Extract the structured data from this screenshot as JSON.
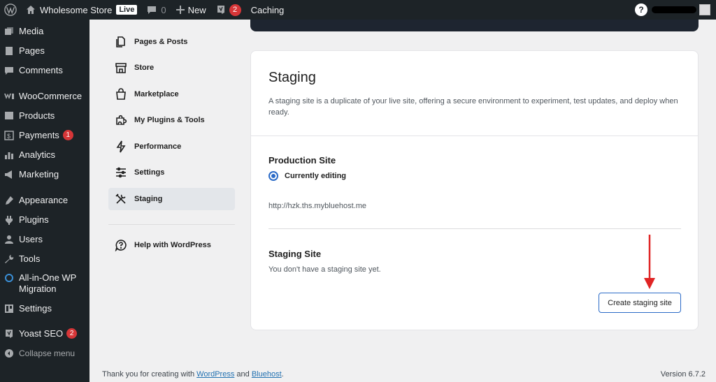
{
  "adminbar": {
    "site_name": "Wholesome Store",
    "live_label": "Live",
    "comments_count": "0",
    "new_label": "New",
    "yoast_badge": "2",
    "caching_label": "Caching",
    "help_label": "?"
  },
  "sidebar": {
    "items": [
      {
        "label": "Media",
        "icon": "media-icon"
      },
      {
        "label": "Pages",
        "icon": "pages-icon"
      },
      {
        "label": "Comments",
        "icon": "comments-icon"
      },
      {
        "label": "WooCommerce",
        "icon": "woocommerce-icon"
      },
      {
        "label": "Products",
        "icon": "products-icon"
      },
      {
        "label": "Payments",
        "icon": "payments-icon",
        "badge": "1"
      },
      {
        "label": "Analytics",
        "icon": "analytics-icon"
      },
      {
        "label": "Marketing",
        "icon": "marketing-icon"
      },
      {
        "label": "Appearance",
        "icon": "appearance-icon"
      },
      {
        "label": "Plugins",
        "icon": "plugins-icon"
      },
      {
        "label": "Users",
        "icon": "users-icon"
      },
      {
        "label": "Tools",
        "icon": "tools-icon"
      },
      {
        "label": "All-in-One WP Migration",
        "icon": "migration-icon"
      },
      {
        "label": "Settings",
        "icon": "settings-icon"
      },
      {
        "label": "Yoast SEO",
        "icon": "yoast-icon",
        "badge": "2"
      }
    ],
    "collapse_label": "Collapse menu"
  },
  "subnav": {
    "items": [
      {
        "label": "Pages & Posts",
        "icon": "pages-posts-icon"
      },
      {
        "label": "Store",
        "icon": "store-icon"
      },
      {
        "label": "Marketplace",
        "icon": "marketplace-icon"
      },
      {
        "label": "My Plugins & Tools",
        "icon": "puzzle-icon"
      },
      {
        "label": "Performance",
        "icon": "lightning-icon"
      },
      {
        "label": "Settings",
        "icon": "sliders-icon"
      },
      {
        "label": "Staging",
        "icon": "tools-crossed-icon",
        "active": true
      }
    ],
    "help_label": "Help with WordPress"
  },
  "staging": {
    "title": "Staging",
    "description": "A staging site is a duplicate of your live site, offering a secure environment to experiment, test updates, and deploy when ready.",
    "production_title": "Production Site",
    "currently_editing": "Currently editing",
    "production_url": "http://hzk.ths.mybluehost.me",
    "staging_title": "Staging Site",
    "staging_empty": "You don't have a staging site yet.",
    "create_button": "Create staging site"
  },
  "footer": {
    "thanks_prefix": "Thank you for creating with",
    "wordpress_link": "WordPress",
    "and_text": "and",
    "bluehost_link": "Bluehost",
    "period": ".",
    "version": "Version 6.7.2"
  },
  "colors": {
    "admin_dark": "#1d2327",
    "accent_blue": "#2a6ac7",
    "badge_red": "#d63638",
    "arrow_red": "#e02424"
  }
}
